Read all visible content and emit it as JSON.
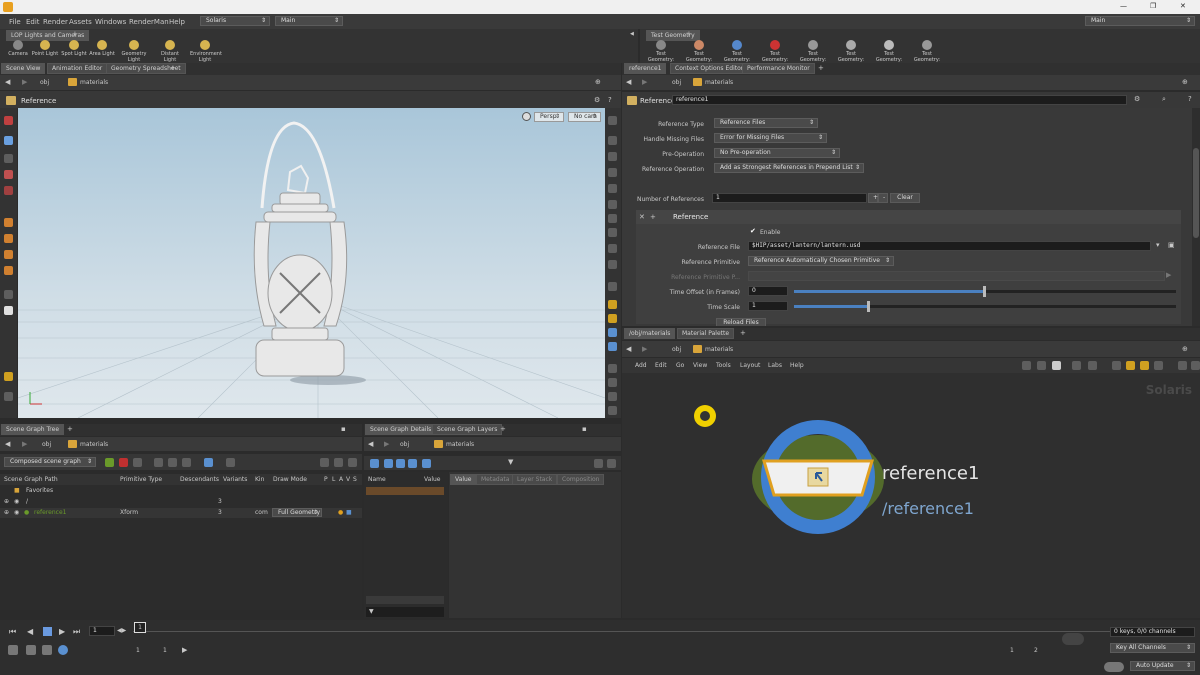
{
  "menubar": {
    "items": [
      "File",
      "Edit",
      "Render",
      "Assets",
      "Windows",
      "RenderMan",
      "Help"
    ],
    "desktop": "Solaris",
    "context": "Main",
    "right_context": "Main"
  },
  "shelf_left": {
    "tab": "LOP Lights and Cameras",
    "tools": [
      "Camera",
      "Point Light",
      "Spot Light",
      "Area Light",
      "Geometry Light",
      "Distant Light",
      "Environment Light"
    ]
  },
  "shelf_right": {
    "tab": "Test Geometry",
    "tools": [
      "Test Geometry: ...",
      "Test Geometry: ...",
      "Test Geometry: ...",
      "Test Geometry: ...",
      "Test Geometry: S...",
      "Test Geometry: S...",
      "Test Geometry: T...",
      "Test Geometry: T..."
    ]
  },
  "viewer": {
    "tabs": [
      "Scene View",
      "Animation Editor",
      "Geometry Spreadsheet"
    ],
    "path": [
      "obj",
      "materials"
    ],
    "title": "Reference",
    "persp": "Persp",
    "cam": "No cam"
  },
  "params": {
    "tabs": [
      "reference1",
      "Context Options Editor",
      "Performance Monitor"
    ],
    "path": [
      "obj",
      "materials"
    ],
    "node_type": "Reference",
    "node_name": "reference1",
    "rows": [
      {
        "label": "Reference Type",
        "value": "Reference Files"
      },
      {
        "label": "Handle Missing Files",
        "value": "Error for Missing Files"
      },
      {
        "label": "Pre-Operation",
        "value": "No Pre-operation"
      },
      {
        "label": "Reference Operation",
        "value": "Add as Strongest References in Prepend List"
      }
    ],
    "num_refs_label": "Number of References",
    "num_refs": "1",
    "clear": "Clear",
    "block_title": "Reference",
    "enable": "Enable",
    "file_label": "Reference File",
    "file_value": "$HIP/asset/lantern/lantern.usd",
    "prim_label": "Reference Primitive",
    "prim_value": "Reference Automatically Chosen Primitive",
    "prim_path_label": "Reference Primitive P...",
    "offset_label": "Time Offset (in Frames)",
    "offset_value": "0",
    "scale_label": "Time Scale",
    "scale_value": "1",
    "reload": "Reload Files"
  },
  "network": {
    "tabs": [
      "/obj/materials",
      "Material Palette"
    ],
    "path": [
      "obj",
      "materials"
    ],
    "menu": [
      "Add",
      "Edit",
      "Go",
      "View",
      "Tools",
      "Layout",
      "Labs",
      "Help"
    ],
    "watermark": "Solaris",
    "node_name": "reference1",
    "node_path": "/reference1"
  },
  "scene_tree": {
    "tab": "Scene Graph Tree",
    "path": [
      "obj",
      "materials"
    ],
    "mode": "Composed scene graph",
    "columns": [
      "Scene Graph Path",
      "Primitive Type",
      "Descendants",
      "Variants",
      "Kin",
      "Draw Mode",
      "P",
      "L",
      "A",
      "V",
      "S"
    ],
    "rows": [
      {
        "path": "Favorites",
        "type": "",
        "desc": "",
        "kind": "",
        "draw": ""
      },
      {
        "path": "/",
        "type": "",
        "desc": "3",
        "kind": "",
        "draw": ""
      },
      {
        "path": "reference1",
        "type": "Xform",
        "desc": "3",
        "kind": "com",
        "draw": "Full Geometry"
      }
    ]
  },
  "scene_details": {
    "tabs": [
      "Scene Graph Details",
      "Scene Graph Layers"
    ],
    "path": [
      "obj",
      "materials"
    ],
    "name_col": "Name",
    "value_col": "Value",
    "subtabs": [
      "Value",
      "Metadata",
      "Layer Stack",
      "Composition"
    ]
  },
  "timeline": {
    "frame": "1",
    "start": "1",
    "start2": "1",
    "end": "1",
    "end2": "2",
    "keys": "0 keys, 0/0 channels",
    "key_all": "Key All Channels",
    "auto_update": "Auto Update"
  },
  "colors": {
    "accent": "#e0a020",
    "node_blue": "#3f7fd0",
    "node_green": "#6a9a2a"
  }
}
